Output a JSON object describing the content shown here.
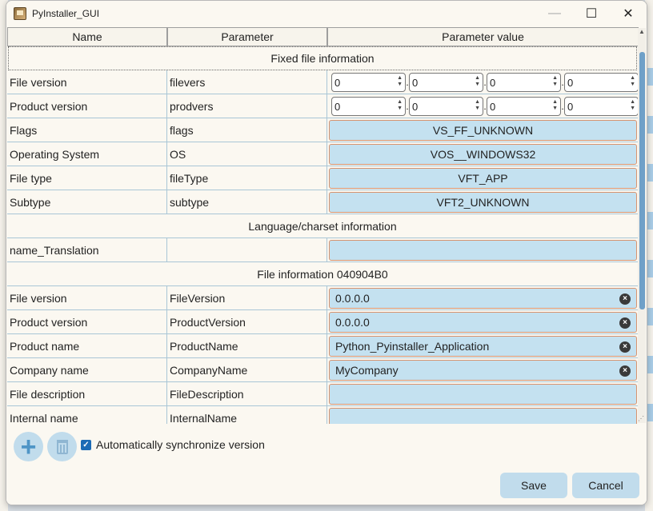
{
  "window": {
    "title": "PyInstaller_GUI",
    "minimize": "—",
    "maximize": "☐",
    "close": "✕"
  },
  "table": {
    "headers": [
      "Name",
      "Parameter",
      "Parameter value"
    ],
    "sections": {
      "fixed": "Fixed file information",
      "lang": "Language/charset information",
      "fileinfo": "File information 040904B0"
    },
    "version_rows": [
      {
        "name": "File version",
        "param": "filevers",
        "values": [
          "0",
          "0",
          "0",
          "0"
        ]
      },
      {
        "name": "Product version",
        "param": "prodvers",
        "values": [
          "0",
          "0",
          "0",
          "0"
        ]
      }
    ],
    "enum_rows": [
      {
        "name": "Flags",
        "param": "flags",
        "value": "VS_FF_UNKNOWN"
      },
      {
        "name": "Operating System",
        "param": "OS",
        "value": "VOS__WINDOWS32"
      },
      {
        "name": "File type",
        "param": "fileType",
        "value": "VFT_APP"
      },
      {
        "name": "Subtype",
        "param": "subtype",
        "value": "VFT2_UNKNOWN"
      }
    ],
    "lang_row": {
      "name": "name_Translation",
      "param": "",
      "value": ""
    },
    "string_rows": [
      {
        "name": "File version",
        "param": "FileVersion",
        "value": "0.0.0.0"
      },
      {
        "name": "Product version",
        "param": "ProductVersion",
        "value": "0.0.0.0"
      },
      {
        "name": "Product name",
        "param": "ProductName",
        "value": "Python_Pyinstaller_Application"
      },
      {
        "name": "Company name",
        "param": "CompanyName",
        "value": "MyCompany"
      },
      {
        "name": "File description",
        "param": "FileDescription",
        "value": ""
      },
      {
        "name": "Internal name",
        "param": "InternalName",
        "value": ""
      }
    ]
  },
  "bottom": {
    "auto_sync_label": "Automatically synchronize version",
    "save": "Save",
    "cancel": "Cancel"
  }
}
